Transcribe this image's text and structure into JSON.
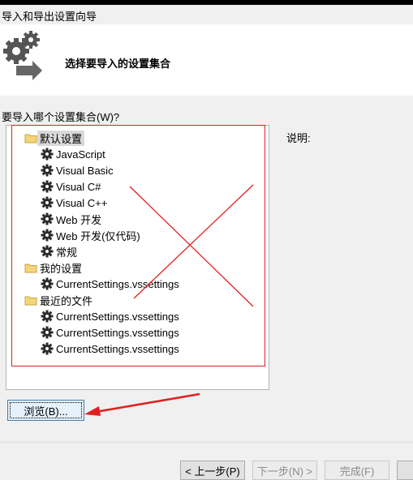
{
  "window": {
    "title": "导入和导出设置向导"
  },
  "header": {
    "heading": "选择要导入的设置集合",
    "logo_icon": "gears-arrow-icon"
  },
  "question": "要导入哪个设置集合(W)?",
  "description_label": "说明:",
  "tree": {
    "groups": [
      {
        "label": "默认设置",
        "icon": "folder-icon",
        "selected": true,
        "items": [
          "JavaScript",
          "Visual Basic",
          "Visual C#",
          "Visual C++",
          "Web 开发",
          "Web 开发(仅代码)",
          "常规"
        ]
      },
      {
        "label": "我的设置",
        "icon": "folder-icon",
        "items": [
          "CurrentSettings.vssettings"
        ]
      },
      {
        "label": "最近的文件",
        "icon": "folder-icon",
        "items": [
          "CurrentSettings.vssettings",
          "CurrentSettings.vssettings",
          "CurrentSettings.vssettings"
        ]
      }
    ]
  },
  "browse_button": "浏览(B)...",
  "footer": {
    "prev": "< 上一步(P)",
    "next": "下一步(N) >",
    "finish": "完成(F)"
  },
  "colors": {
    "annotation": "#e02020",
    "folder": "#f4d67a"
  }
}
